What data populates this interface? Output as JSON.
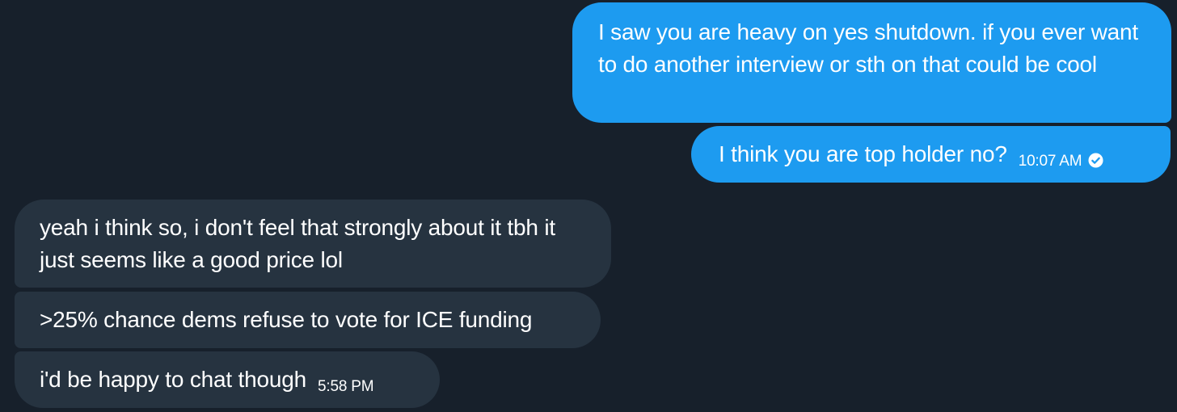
{
  "conversation": {
    "messages": [
      {
        "direction": "sent",
        "text": "I saw you are heavy on yes shutdown. if you ever want to do another interview or sth on that could be cool"
      },
      {
        "direction": "sent",
        "text": "I think you are top holder no?",
        "time": "10:07 AM",
        "status_icon": "read-check-icon"
      },
      {
        "direction": "received",
        "text": "yeah i think so, i don't feel that strongly about it tbh it just seems like a good price lol"
      },
      {
        "direction": "received",
        "text": ">25% chance dems refuse to vote for ICE funding"
      },
      {
        "direction": "received",
        "text": "i'd be happy to chat though",
        "time": "5:58 PM"
      }
    ]
  },
  "colors": {
    "background": "#17202b",
    "sent_bubble": "#1d9bf0",
    "received_bubble": "#263340",
    "text": "#ffffff"
  }
}
